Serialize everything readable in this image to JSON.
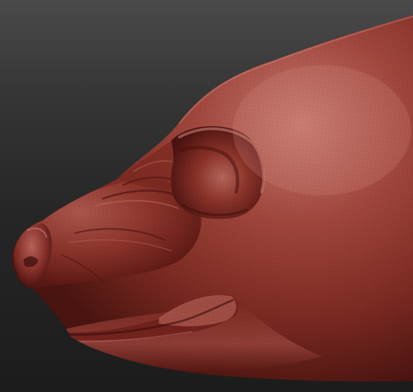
{
  "viewport": {
    "background_top": "#4a4a4a",
    "background_bottom": "#1c1c1c"
  },
  "model": {
    "subject": "sculpted-animal-head",
    "material_color": "#8a3028",
    "highlight_color": "#c9766a",
    "shadow_color": "#3a0c0a",
    "wireframe_visible": true
  }
}
